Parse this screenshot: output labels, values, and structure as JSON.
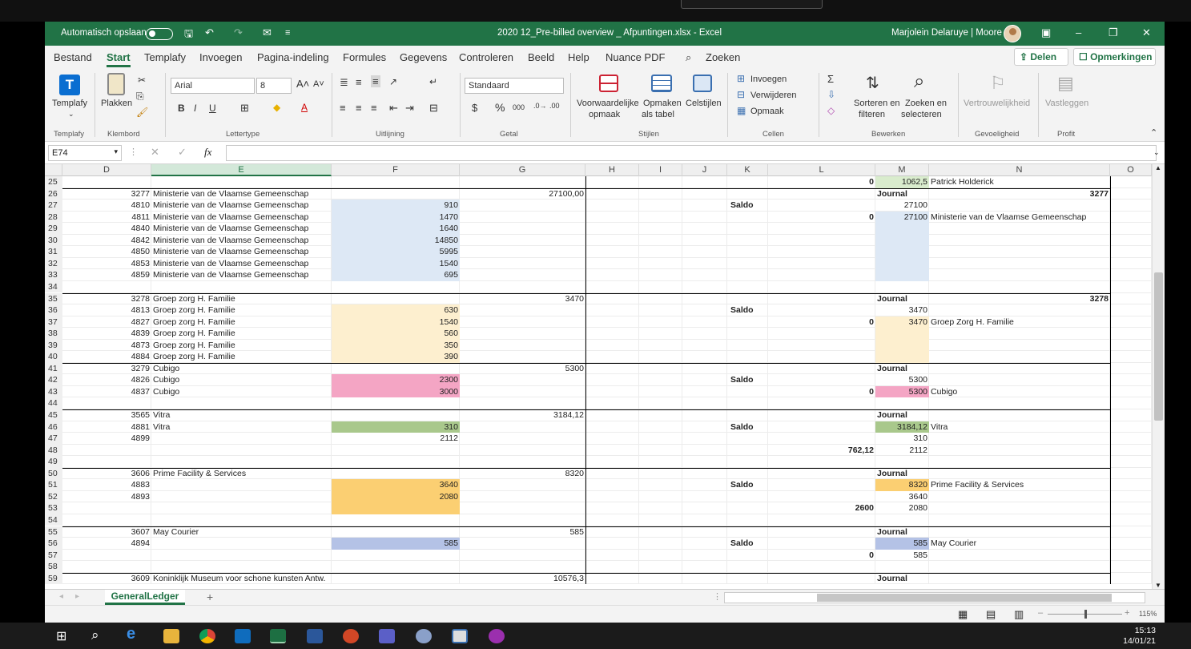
{
  "window": {
    "autosave_label": "Automatisch opslaan",
    "title": "2020 12_Pre-billed overview _ Afpuntingen.xlsx  -  Excel",
    "user": "Marjolein Delaruye | Moore"
  },
  "menu": {
    "items": [
      "Bestand",
      "Start",
      "Templafy",
      "Invoegen",
      "Pagina-indeling",
      "Formules",
      "Gegevens",
      "Controleren",
      "Beeld",
      "Help",
      "Nuance PDF"
    ],
    "search": "Zoeken",
    "share": "Delen",
    "comments": "Opmerkingen"
  },
  "ribbon": {
    "templafy": "Templafy",
    "paste": "Plakken",
    "font_name": "Arial",
    "font_size": "8",
    "number_format": "Standaard",
    "conditional": [
      "Voorwaardelijke",
      "opmaak"
    ],
    "format_table": [
      "Opmaken",
      "als tabel"
    ],
    "cell_styles": "Celstijlen",
    "insert": "Invoegen",
    "delete": "Verwijderen",
    "format": "Opmaak",
    "sort": [
      "Sorteren en",
      "filteren"
    ],
    "find": [
      "Zoeken en",
      "selecteren"
    ],
    "sensitivity": "Vertrouwelijkheid",
    "pin": "Vastleggen",
    "groups": [
      "Templafy",
      "Klembord",
      "Lettertype",
      "Uitlijning",
      "Getal",
      "Stijlen",
      "Cellen",
      "Bewerken",
      "Gevoeligheid",
      "Profit"
    ]
  },
  "formula": {
    "namebox": "E74",
    "fx": "fx"
  },
  "columns": [
    "D",
    "E",
    "F",
    "G",
    "H",
    "I",
    "J",
    "K",
    "L",
    "M",
    "N",
    "O"
  ],
  "rows": [
    {
      "n": "25",
      "L": "0",
      "M": "1062,5",
      "N": "Patrick Holderick"
    },
    {
      "n": "26",
      "D": "3277",
      "E": "Ministerie van de Vlaamse Gemeenschap",
      "G": "27100,00",
      "M": "Journal",
      "N": "3277"
    },
    {
      "n": "27",
      "D": "4810",
      "E": "Ministerie van de Vlaamse Gemeenschap",
      "F": "910",
      "K": "Saldo",
      "M": "27100"
    },
    {
      "n": "28",
      "D": "4811",
      "E": "Ministerie van de Vlaamse Gemeenschap",
      "F": "1470",
      "L": "0",
      "M": "27100",
      "N": "Ministerie van de Vlaamse Gemeenschap"
    },
    {
      "n": "29",
      "D": "4840",
      "E": "Ministerie van de Vlaamse Gemeenschap",
      "F": "1640"
    },
    {
      "n": "30",
      "D": "4842",
      "E": "Ministerie van de Vlaamse Gemeenschap",
      "F": "14850"
    },
    {
      "n": "31",
      "D": "4850",
      "E": "Ministerie van de Vlaamse Gemeenschap",
      "F": "5995"
    },
    {
      "n": "32",
      "D": "4853",
      "E": "Ministerie van de Vlaamse Gemeenschap",
      "F": "1540"
    },
    {
      "n": "33",
      "D": "4859",
      "E": "Ministerie van de Vlaamse Gemeenschap",
      "F": "695"
    },
    {
      "n": "34"
    },
    {
      "n": "35",
      "D": "3278",
      "E": "Groep zorg H. Familie",
      "G": "3470",
      "M": "Journal",
      "N": "3278"
    },
    {
      "n": "36",
      "D": "4813",
      "E": "Groep zorg H. Familie",
      "F": "630",
      "K": "Saldo",
      "M": "3470"
    },
    {
      "n": "37",
      "D": "4827",
      "E": "Groep zorg H. Familie",
      "F": "1540",
      "L": "0",
      "M": "3470",
      "N": "Groep Zorg H. Familie"
    },
    {
      "n": "38",
      "D": "4839",
      "E": "Groep zorg H. Familie",
      "F": "560"
    },
    {
      "n": "39",
      "D": "4873",
      "E": "Groep zorg H. Familie",
      "F": "350"
    },
    {
      "n": "40",
      "D": "4884",
      "E": "Groep zorg H. Familie",
      "F": "390"
    },
    {
      "n": "41",
      "D": "3279",
      "E": "Cubigo",
      "G": "5300",
      "M": "Journal"
    },
    {
      "n": "42",
      "D": "4826",
      "E": "Cubigo",
      "F": "2300",
      "K": "Saldo",
      "M": "5300"
    },
    {
      "n": "43",
      "D": "4837",
      "E": "Cubigo",
      "F": "3000",
      "L": "0",
      "M": "5300",
      "N": "Cubigo"
    },
    {
      "n": "44"
    },
    {
      "n": "45",
      "D": "3565",
      "E": "Vitra",
      "G": "3184,12",
      "M": "Journal"
    },
    {
      "n": "46",
      "D": "4881",
      "E": "Vitra",
      "F": "310",
      "K": "Saldo",
      "M": "3184,12",
      "N": "Vitra"
    },
    {
      "n": "47",
      "D": "4899",
      "F": "2112",
      "M": "310"
    },
    {
      "n": "48",
      "L": "762,12",
      "M": "2112"
    },
    {
      "n": "49"
    },
    {
      "n": "50",
      "D": "3606",
      "E": "Prime Facility & Services",
      "G": "8320",
      "M": "Journal"
    },
    {
      "n": "51",
      "D": "4883",
      "F": "3640",
      "K": "Saldo",
      "M": "8320",
      "N": "Prime Facility & Services"
    },
    {
      "n": "52",
      "D": "4893",
      "F": "2080",
      "M": "3640"
    },
    {
      "n": "53",
      "L": "2600",
      "M": "2080"
    },
    {
      "n": "54"
    },
    {
      "n": "55",
      "D": "3607",
      "E": "May Courier",
      "G": "585",
      "M": "Journal"
    },
    {
      "n": "56",
      "D": "4894",
      "F": "585",
      "K": "Saldo",
      "M": "585",
      "N": "May Courier"
    },
    {
      "n": "57",
      "L": "0",
      "M": "585"
    },
    {
      "n": "58"
    },
    {
      "n": "59",
      "D": "3609",
      "E": "Koninklijk Museum voor schone kunsten Antw.",
      "G": "10576,3",
      "M": "Journal"
    }
  ],
  "fills": {
    "blue": "#dde8f5",
    "cream": "#fdefcf",
    "pink": "#f4a5c4",
    "green": "#a9c88c",
    "orange": "#fbcf72",
    "lavender": "#b4c2e6",
    "lightgreen": "#d9eccd"
  },
  "sheet": {
    "tab": "GeneralLedger",
    "add": "+"
  },
  "status": {
    "zoom": "115%"
  },
  "clock": {
    "time": "15:13",
    "date": "14/01/21"
  }
}
